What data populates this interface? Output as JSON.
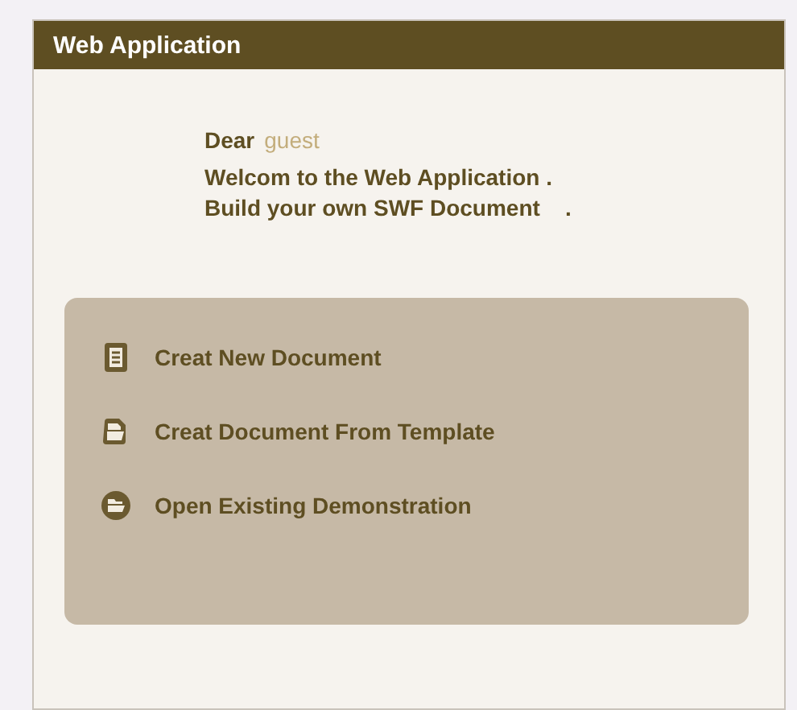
{
  "window": {
    "title": "Web Application"
  },
  "greeting": {
    "salutation": "Dear",
    "user": "guest",
    "lines": [
      "Welcom to the Web Application .",
      "Build your own SWF Document    ."
    ]
  },
  "actions": [
    {
      "kind": "document",
      "label": "Creat New Document"
    },
    {
      "kind": "template",
      "label": "Creat Document From Template"
    },
    {
      "kind": "open",
      "label": "Open Existing Demonstration"
    }
  ]
}
